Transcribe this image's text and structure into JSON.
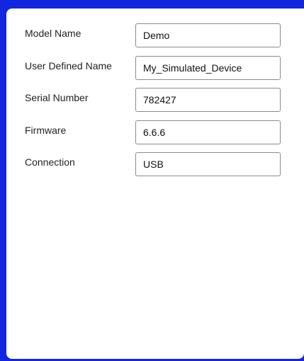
{
  "accent_color": "#1226e0",
  "fields": [
    {
      "label": "Model Name",
      "value": "Demo"
    },
    {
      "label": "User Defined Name",
      "value": "My_Simulated_Device"
    },
    {
      "label": "Serial Number",
      "value": "782427"
    },
    {
      "label": "Firmware",
      "value": "6.6.6"
    },
    {
      "label": "Connection",
      "value": "USB"
    }
  ]
}
